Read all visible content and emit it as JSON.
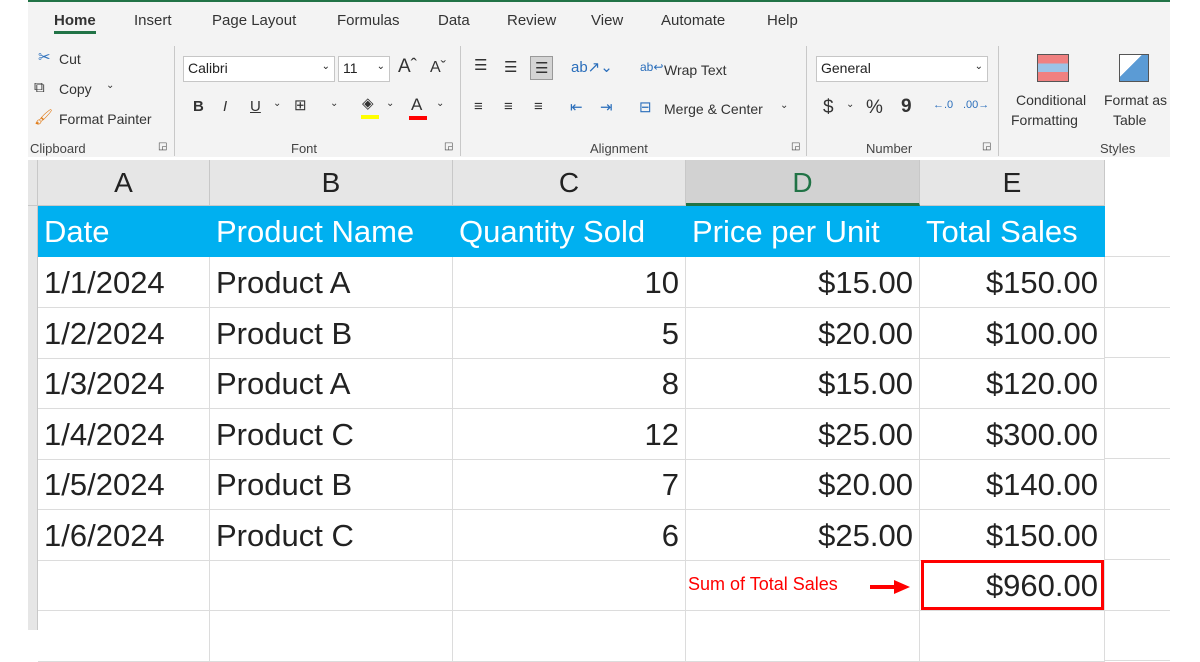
{
  "ribbon": {
    "tabs": [
      "Home",
      "Insert",
      "Page Layout",
      "Formulas",
      "Data",
      "Review",
      "View",
      "Automate",
      "Help"
    ],
    "active_tab": "Home",
    "clipboard": {
      "cut": "Cut",
      "copy": "Copy",
      "format_painter": "Format Painter",
      "group": "Clipboard"
    },
    "font": {
      "name": "Calibri",
      "size": "11",
      "bold": "B",
      "italic": "I",
      "underline": "U",
      "color_letter": "A",
      "group": "Font",
      "fill_color": "#ffff00",
      "font_color": "#ff0000"
    },
    "alignment": {
      "wrap_text": "Wrap Text",
      "merge_center": "Merge & Center",
      "group": "Alignment"
    },
    "number": {
      "format": "General",
      "currency": "$",
      "percent": "%",
      "comma": "9",
      "group": "Number"
    },
    "styles": {
      "conditional": "Conditional",
      "formatting": "Formatting",
      "format_as": "Format as",
      "table": "Table",
      "group": "Styles"
    }
  },
  "sheet": {
    "columns": [
      "A",
      "B",
      "C",
      "D",
      "E"
    ],
    "selected_column": "D",
    "header_color": "#00b0f0",
    "headers": [
      "Date",
      "Product Name",
      "Quantity Sold",
      "Price per Unit",
      "Total Sales"
    ],
    "rows": [
      [
        "1/1/2024",
        "Product A",
        "10",
        "$15.00",
        "$150.00"
      ],
      [
        "1/2/2024",
        "Product B",
        "5",
        "$20.00",
        "$100.00"
      ],
      [
        "1/3/2024",
        "Product A",
        "8",
        "$15.00",
        "$120.00"
      ],
      [
        "1/4/2024",
        "Product C",
        "12",
        "$25.00",
        "$300.00"
      ],
      [
        "1/5/2024",
        "Product B",
        "7",
        "$20.00",
        "$140.00"
      ],
      [
        "1/6/2024",
        "Product C",
        "6",
        "$25.00",
        "$150.00"
      ]
    ],
    "sum_value": "$960.00",
    "annotation": "Sum of Total Sales",
    "annotation_color": "#ff0000"
  }
}
